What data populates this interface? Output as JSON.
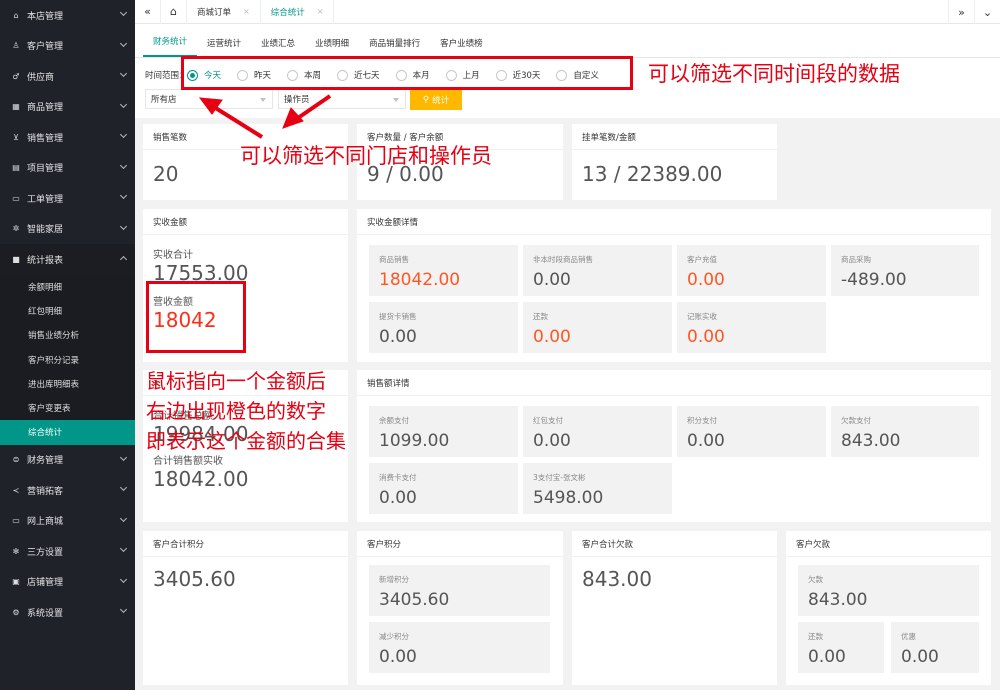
{
  "sidebar": {
    "items": [
      {
        "label": "本店管理",
        "icon": "home-icon"
      },
      {
        "label": "客户管理",
        "icon": "user-icon"
      },
      {
        "label": "供应商",
        "icon": "gender-icon"
      },
      {
        "label": "商品管理",
        "icon": "grid-icon"
      },
      {
        "label": "销售管理",
        "icon": "cart-icon"
      },
      {
        "label": "项目管理",
        "icon": "list-icon"
      },
      {
        "label": "工单管理",
        "icon": "doc-icon"
      },
      {
        "label": "智能家居",
        "icon": "gear-icon"
      },
      {
        "label": "统计报表",
        "icon": "chat-icon"
      }
    ],
    "sub_items": [
      "余额明细",
      "红包明细",
      "销售业绩分析",
      "客户积分记录",
      "进出库明细表",
      "客户变更表",
      "综合统计"
    ],
    "items_after": [
      {
        "label": "财务管理",
        "icon": "finance-icon"
      },
      {
        "label": "营销拓客",
        "icon": "share-icon"
      },
      {
        "label": "网上商城",
        "icon": "store-icon"
      },
      {
        "label": "三方设置",
        "icon": "snowflake-icon"
      },
      {
        "label": "店铺管理",
        "icon": "shop-icon"
      },
      {
        "label": "系统设置",
        "icon": "settings-icon"
      }
    ]
  },
  "topbar": {
    "tabs": [
      {
        "label": "商城订单",
        "close": "×"
      },
      {
        "label": "综合统计",
        "close": "×"
      }
    ],
    "left_glyph": "«",
    "right_glyph": "»"
  },
  "subtabs": [
    "财务统计",
    "运营统计",
    "业绩汇总",
    "业绩明细",
    "商品销量排行",
    "客户业绩榜"
  ],
  "filter": {
    "label": "时间范围：",
    "options": [
      "今天",
      "昨天",
      "本周",
      "近七天",
      "本月",
      "上月",
      "近30天",
      "自定义"
    ],
    "selected": "今天",
    "store_select": "所有店",
    "operator_select": "操作员",
    "stat_button": "统计"
  },
  "cards": {
    "sales_count": {
      "title": "销售笔数",
      "value": "20"
    },
    "customers": {
      "title": "客户数量 / 客户余额",
      "value": "9 / 0.00"
    },
    "pending": {
      "title": "挂单笔数/金额",
      "value": "13 / 22389.00"
    },
    "received": {
      "title": "实收金额",
      "total_label": "实收合计",
      "total_value": "17553.00",
      "revenue_label": "营收金额",
      "revenue_value": "18042"
    },
    "received_detail": {
      "title": "实收金额详情",
      "boxes": [
        {
          "label": "商品销售",
          "value": "18042.00",
          "orange": true
        },
        {
          "label": "非本时段商品销售",
          "value": "0.00",
          "orange": false
        },
        {
          "label": "客户充值",
          "value": "0.00",
          "orange": true
        },
        {
          "label": "商品采购",
          "value": "-489.00",
          "orange": false
        },
        {
          "label": "提货卡销售",
          "value": "0.00",
          "orange": false
        },
        {
          "label": "还款",
          "value": "0.00",
          "orange": true
        },
        {
          "label": "记账实收",
          "value": "0.00",
          "orange": true
        }
      ]
    },
    "sales_summary": {
      "title_partial": "ä",
      "label1": "合计销售总额",
      "value1": "19984.00",
      "label2": "合计销售额实收",
      "value2": "18042.00"
    },
    "sales_detail": {
      "title": "销售额详情",
      "boxes": [
        {
          "label": "余额支付",
          "value": "1099.00"
        },
        {
          "label": "红包支付",
          "value": "0.00"
        },
        {
          "label": "积分支付",
          "value": "0.00"
        },
        {
          "label": "欠款支付",
          "value": "843.00"
        },
        {
          "label": "消费卡支付",
          "value": "0.00"
        },
        {
          "label": "3支付宝-张文彬",
          "value": "5498.00"
        }
      ]
    },
    "points_total": {
      "title": "客户合计积分",
      "value": "3405.60"
    },
    "points": {
      "title": "客户积分",
      "boxes": [
        {
          "label": "新增积分",
          "value": "3405.60"
        },
        {
          "label": "减少积分",
          "value": "0.00"
        }
      ]
    },
    "debt_total": {
      "title": "客户合计欠款",
      "value": "843.00"
    },
    "debt": {
      "title": "客户欠款",
      "boxes": [
        {
          "label": "欠款",
          "value": "843.00"
        },
        {
          "label": "还款",
          "value": "0.00"
        },
        {
          "label": "优惠",
          "value": "0.00"
        }
      ]
    }
  },
  "annotations": {
    "time_filter": "可以筛选不同时间段的数据",
    "store_filter": "可以筛选不同门店和操作员",
    "hover_line1": "鼠标指向一个金额后",
    "hover_line2": "右边出现橙色的数字",
    "hover_line3": "即表示这个金额的合集"
  },
  "colors": {
    "sidebar_bg": "#20222a",
    "accent": "#009688",
    "orange": "#ff5722",
    "annotation_red": "#e60012",
    "button_yellow": "#ffb800"
  }
}
